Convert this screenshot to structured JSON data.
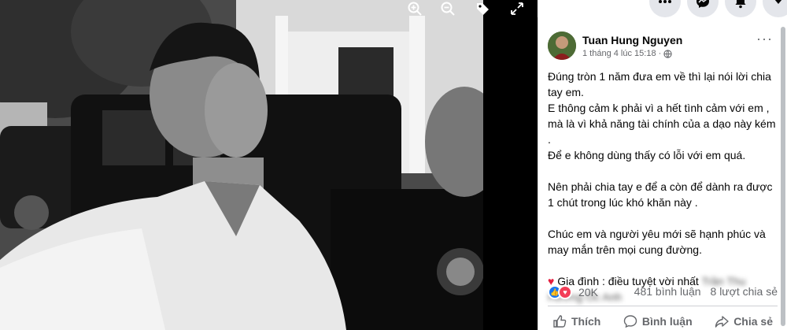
{
  "viewer": {
    "zoom_in_icon": "zoom-in-icon",
    "zoom_out_icon": "zoom-out-icon",
    "tag_icon": "tag-icon",
    "fullscreen_icon": "fullscreen-icon"
  },
  "topnav": {
    "icons": [
      "menu-grid-icon",
      "messenger-icon",
      "notifications-icon",
      "account-dropdown-icon"
    ]
  },
  "post": {
    "author": "Tuan Hung Nguyen",
    "timestamp": "1 tháng 4 lúc 15:18",
    "privacy_icon": "globe-icon",
    "more_label": "···",
    "paragraphs": [
      "Đúng tròn 1 năm đưa em về thì lại nói lời chia tay em.",
      "E thông cảm k phải vì a hết tình cảm với em , mà là vì khả năng tài chính của a dạo này kém .",
      "Để e không dùng thấy có lỗi với em quá.",
      "",
      "Nên phải chia tay e để a còn để dành ra được 1 chút trong lúc khó khăn này .",
      "",
      "Chúc em và người yêu mới sẽ hạnh phúc và may mắn trên mọi cung đường.",
      ""
    ],
    "tag_heart": "♥",
    "tag_line": "Gia đình : điều tuyệt vời nhất",
    "tag_blurred_1": "Trần Thu",
    "tag_blurred_2": "Hương",
    "tag_blurred_3": "Ốc Anh"
  },
  "stats": {
    "reaction_count": "20K",
    "comments": "481 bình luận",
    "shares": "8 lượt chia sẻ"
  },
  "actions": {
    "like": "Thích",
    "comment": "Bình luận",
    "share": "Chia sẻ"
  },
  "colors": {
    "accent": "#1877f2",
    "love": "#f33e58",
    "text_primary": "#050505",
    "text_secondary": "#65676b"
  }
}
